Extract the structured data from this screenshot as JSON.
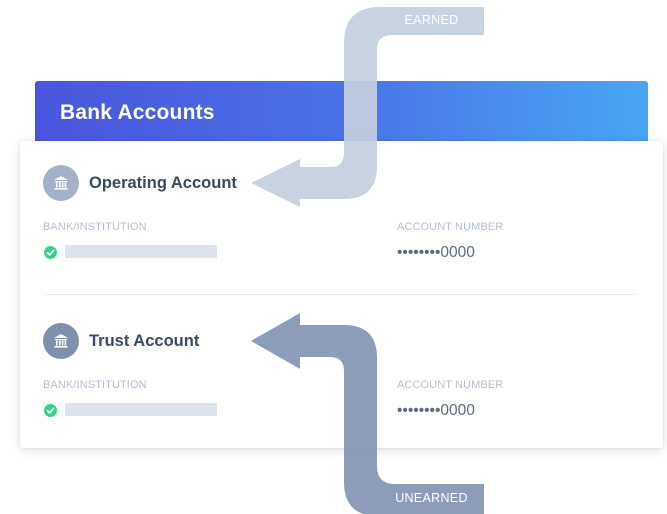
{
  "header": {
    "title": "Bank Accounts"
  },
  "accounts": [
    {
      "title": "Operating Account",
      "bank_label": "BANK/INSTITUTION",
      "number_label": "ACCOUNT NUMBER",
      "account_number": "••••••••0000",
      "icon": "bank-icon",
      "verified_icon": "check-circle-icon"
    },
    {
      "title": "Trust Account",
      "bank_label": "BANK/INSTITUTION",
      "number_label": "ACCOUNT NUMBER",
      "account_number": "••••••••0000",
      "icon": "bank-icon",
      "verified_icon": "check-circle-icon"
    }
  ],
  "annotations": {
    "earned_label": "EARNED",
    "unearned_label": "UNEARNED"
  },
  "colors": {
    "header_gradient_start": "#4a55dd",
    "header_gradient_end": "#49a6f5",
    "earned_arrow": "#c3cfe0",
    "unearned_arrow": "#8798b5",
    "verified_green": "#3dd28a"
  }
}
